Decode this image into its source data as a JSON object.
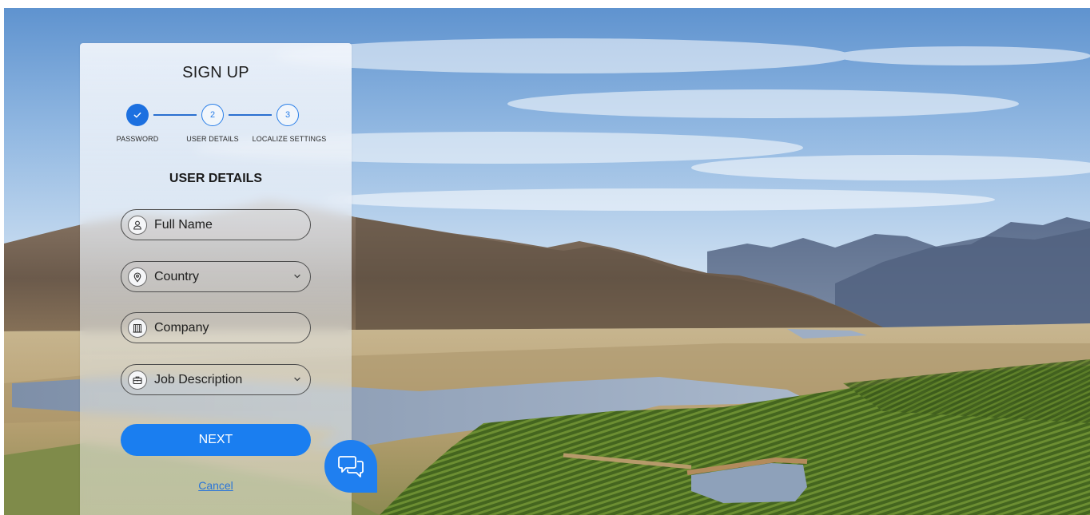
{
  "signup": {
    "title": "SIGN UP",
    "section_title": "USER DETAILS",
    "steps": [
      {
        "number": "",
        "label": "PASSWORD",
        "state": "completed",
        "icon": "check-icon"
      },
      {
        "number": "2",
        "label": "USER DETAILS",
        "state": "current"
      },
      {
        "number": "3",
        "label": "LOCALIZE SETTINGS",
        "state": "upcoming"
      }
    ],
    "fields": {
      "full_name": {
        "placeholder": "Full Name",
        "icon": "user-icon"
      },
      "country": {
        "placeholder": "Country",
        "icon": "location-pin-icon"
      },
      "company": {
        "placeholder": "Company",
        "icon": "building-icon"
      },
      "job_description": {
        "placeholder": "Job Description",
        "icon": "briefcase-icon"
      }
    },
    "next_label": "NEXT",
    "cancel_label": "Cancel"
  },
  "chat": {
    "icon": "chat-bubbles-icon"
  },
  "colors": {
    "accent": "#1a7ef0",
    "step_complete": "#1c70e0",
    "link": "#2a75d8"
  }
}
